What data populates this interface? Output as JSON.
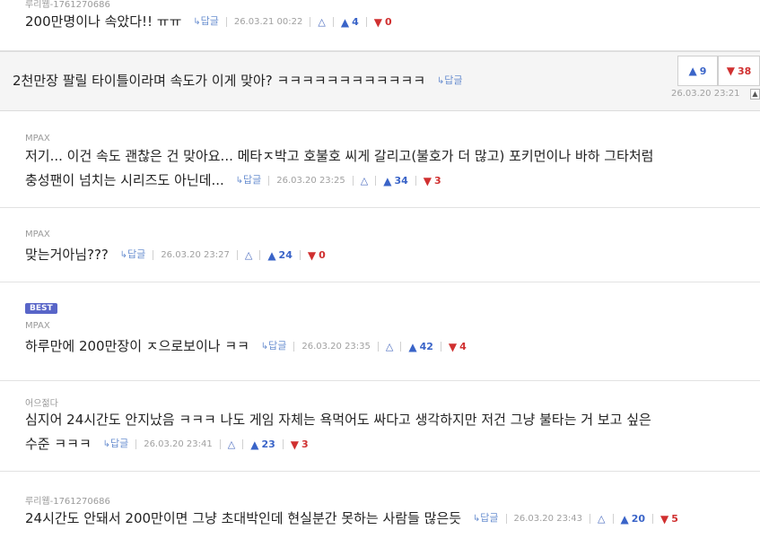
{
  "reply_label": "답글",
  "comments": [
    {
      "author": "루리웹-1761270686",
      "text": "200만명이나 속았다!! ㅠㅠ",
      "date": "26.03.21 00:22",
      "up": "4",
      "down": "0"
    },
    {
      "author": "",
      "text": "2천만장 팔릴 타이틀이라며 속도가 이게 맞아? ㅋㅋㅋㅋㅋㅋㅋㅋㅋㅋㅋㅋ",
      "date": "26.03.20 23:21",
      "up": "9",
      "down": "38"
    },
    {
      "author": "MPAX",
      "text_line1": "저기... 이건 속도 괜찮은 건 맞아요... 메타ㅈ박고 호불호 씨게 갈리고(불호가 더 많고) 포키먼이나 바하 그타처럼",
      "text_line2": "충성팬이 넘치는 시리즈도 아닌데...",
      "date": "26.03.20 23:25",
      "up": "34",
      "down": "3"
    },
    {
      "author": "MPAX",
      "text": "맞는거아님???",
      "date": "26.03.20 23:27",
      "up": "24",
      "down": "0"
    },
    {
      "badge": "BEST",
      "author": "MPAX",
      "text": "하루만에 200만장이 ㅈ으로보이나 ㅋㅋ",
      "date": "26.03.20 23:35",
      "up": "42",
      "down": "4"
    },
    {
      "author": "어으젊다",
      "text_line1": "심지어 24시간도 안지났음 ㅋㅋㅋ 나도 게임 자체는 욕먹어도 싸다고 생각하지만 저건 그냥 불타는 거 보고 싶은",
      "text_line2": "수준 ㅋㅋㅋ",
      "date": "26.03.20 23:41",
      "up": "23",
      "down": "3"
    },
    {
      "author": "루리웹-1761270686",
      "text": "24시간도 안돼서 200만이면 그냥 초대박인데 현실분간 못하는 사람들 많은듯",
      "date": "26.03.20 23:43",
      "up": "20",
      "down": "5"
    }
  ]
}
